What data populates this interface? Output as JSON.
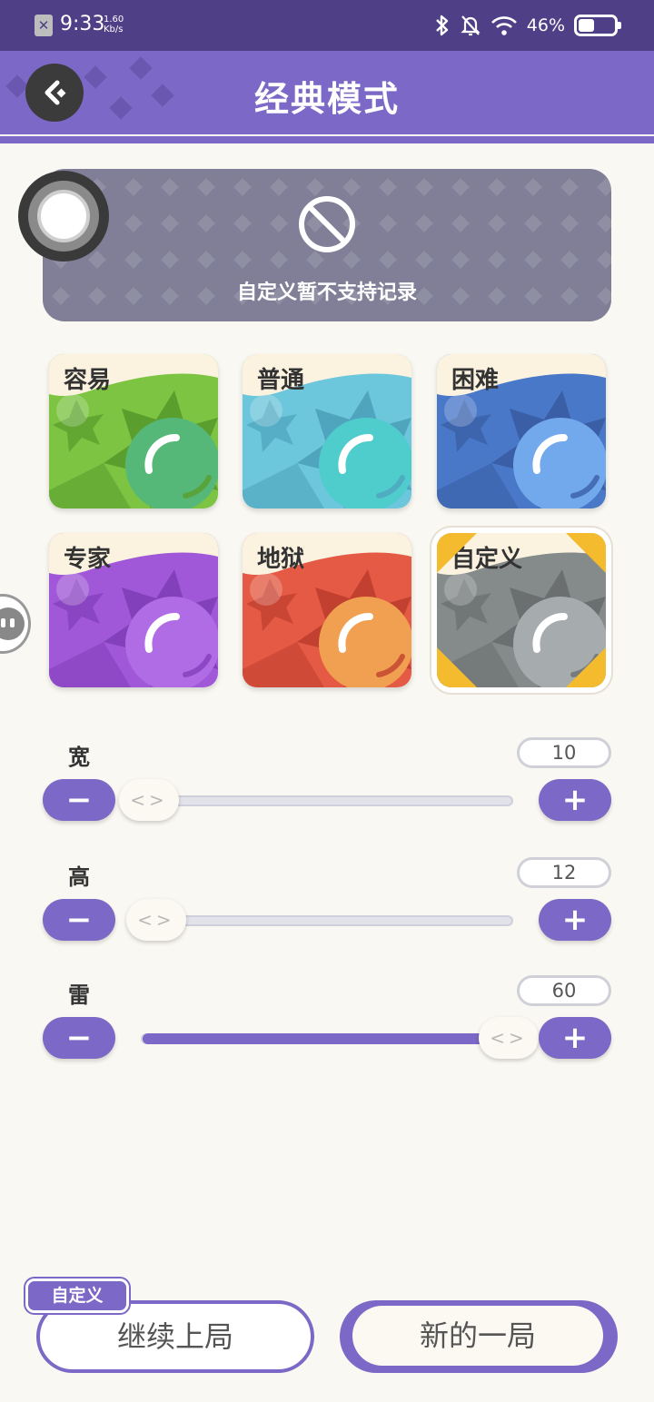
{
  "status_bar": {
    "time": "9:33",
    "speed_value": "1.60",
    "speed_unit": "Kb/s",
    "battery_text": "46%",
    "battery_level": 0.46
  },
  "header": {
    "title": "经典模式"
  },
  "notice": {
    "text": "自定义暂不支持记录"
  },
  "difficulty_cards": [
    {
      "label": "容易",
      "bg": "#7cc442",
      "dark": "#5a9e2e",
      "ball": "#56b878"
    },
    {
      "label": "普通",
      "bg": "#6cc6dc",
      "dark": "#4ea5bd",
      "ball": "#4fcccc"
    },
    {
      "label": "困难",
      "bg": "#4a78c8",
      "dark": "#3a5fa6",
      "ball": "#72a8ec"
    },
    {
      "label": "专家",
      "bg": "#a058d8",
      "dark": "#8340bb",
      "ball": "#b06ce4"
    },
    {
      "label": "地狱",
      "bg": "#e45a44",
      "dark": "#c2402f",
      "ball": "#f0a050"
    },
    {
      "label": "自定义",
      "bg": "#858a8a",
      "dark": "#6b6f70",
      "ball": "#a6acae",
      "selected": true
    }
  ],
  "sliders": {
    "width": {
      "label": "宽",
      "value": "10",
      "level": 0.0
    },
    "height": {
      "label": "高",
      "value": "12",
      "level": 0.02
    },
    "mines": {
      "label": "雷",
      "value": "60",
      "level": 1.0
    }
  },
  "footer": {
    "tag": "自定义",
    "continue_label": "继续上局",
    "new_label": "新的一局"
  },
  "colors": {
    "accent": "#7c68c6",
    "status_bar": "#4e3f86",
    "background": "#faf8f2",
    "selected_corner": "#f4bb2e"
  }
}
